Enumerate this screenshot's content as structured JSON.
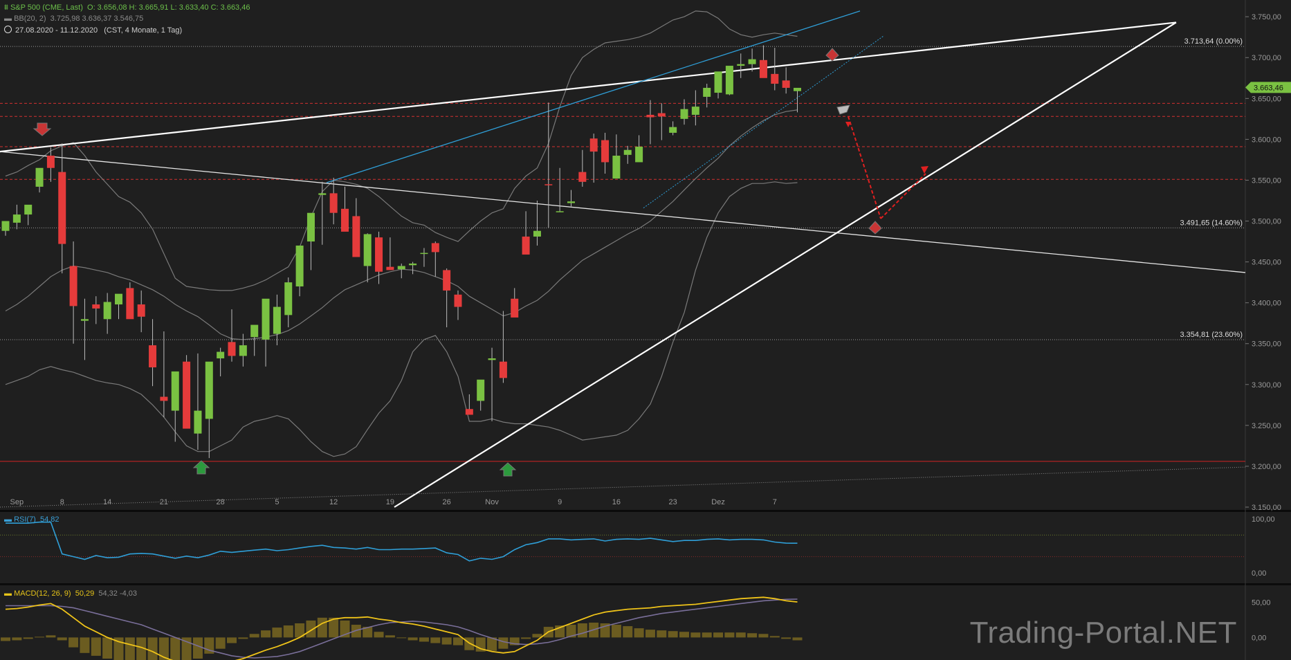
{
  "header": {
    "symbol_icon": "candlestick-icon",
    "symbol": "S&P 500 (CME, Last)",
    "ohlc": "O: 3.656,08  H: 3.665,91  L: 3.633,40  C: 3.663,46",
    "bb_label": "BB(20, 2)",
    "bb_values": "3.725,98  3.636,37  3.546,75",
    "range_icon": "clock-icon",
    "range": "27.08.2020 - 11.12.2020",
    "range_note": "(CST, 4 Monate, 1 Tag)"
  },
  "watermark": "Trading-Portal.NET",
  "colors": {
    "background": "#1f1f1f",
    "up": "#7ac142",
    "down": "#e53b3b",
    "rsi": "#2f9fd8",
    "macd": "#f0c419",
    "signal": "#7a6f9a",
    "hist": "#6b5c20"
  },
  "chart_data": [
    {
      "type": "candlestick",
      "title": "S&P 500 (CME, Last)",
      "x": [
        "31.08",
        "01.09",
        "02.09",
        "03.09",
        "04.09",
        "08.09",
        "09.09",
        "10.09",
        "11.09",
        "14.09",
        "15.09",
        "16.09",
        "17.09",
        "18.09",
        "21.09",
        "22.09",
        "23.09",
        "24.09",
        "25.09",
        "28.09",
        "29.09",
        "30.09",
        "01.10",
        "02.10",
        "05.10",
        "06.10",
        "07.10",
        "08.10",
        "09.10",
        "12.10",
        "13.10",
        "14.10",
        "15.10",
        "16.10",
        "19.10",
        "20.10",
        "21.10",
        "22.10",
        "23.10",
        "26.10",
        "27.10",
        "28.10",
        "29.10",
        "30.10",
        "02.11",
        "03.11",
        "04.11",
        "05.11",
        "06.11",
        "09.11",
        "10.11",
        "11.11",
        "12.11",
        "13.11",
        "16.11",
        "17.11",
        "18.11",
        "19.11",
        "20.11",
        "23.11",
        "24.11",
        "25.11",
        "27.11",
        "30.11",
        "01.12",
        "02.12",
        "03.12",
        "04.12",
        "07.12",
        "08.12",
        "09.12",
        "10.12",
        "11.12"
      ],
      "open": [
        3488,
        3498,
        3508,
        3542,
        3580,
        3560,
        3445,
        3378,
        3398,
        3380,
        3398,
        3418,
        3398,
        3348,
        3285,
        3268,
        3328,
        3240,
        3258,
        3332,
        3352,
        3335,
        3358,
        3355,
        3362,
        3385,
        3420,
        3475,
        3532,
        3534,
        3515,
        3506,
        3445,
        3480,
        3444,
        3441,
        3446,
        3460,
        3473,
        3440,
        3410,
        3270,
        3280,
        3330,
        3328,
        3405,
        3481,
        3481,
        3545,
        3511,
        3522,
        3560,
        3601,
        3599,
        3552,
        3581,
        3572,
        3630,
        3632,
        3608,
        3625,
        3630,
        3652,
        3657,
        3655,
        3690,
        3692,
        3697,
        3680,
        3672,
        3659
      ],
      "high": [
        3498,
        3520,
        3518,
        3550,
        3590,
        3595,
        3475,
        3405,
        3408,
        3412,
        3402,
        3425,
        3415,
        3380,
        3365,
        3290,
        3336,
        3338,
        3302,
        3345,
        3392,
        3362,
        3368,
        3385,
        3410,
        3431,
        3421,
        3482,
        3548,
        3553,
        3542,
        3528,
        3485,
        3487,
        3480,
        3448,
        3450,
        3467,
        3475,
        3442,
        3415,
        3288,
        3300,
        3345,
        3390,
        3418,
        3512,
        3525,
        3645,
        3565,
        3538,
        3587,
        3607,
        3608,
        3606,
        3592,
        3605,
        3648,
        3644,
        3622,
        3649,
        3660,
        3668,
        3680,
        3682,
        3705,
        3711,
        3715,
        3712,
        3688,
        3663
      ],
      "low": [
        3482,
        3490,
        3495,
        3535,
        3548,
        3436,
        3350,
        3330,
        3374,
        3362,
        3380,
        3390,
        3364,
        3298,
        3260,
        3230,
        3278,
        3220,
        3210,
        3310,
        3328,
        3322,
        3335,
        3322,
        3348,
        3370,
        3408,
        3440,
        3471,
        3496,
        3498,
        3490,
        3425,
        3423,
        3440,
        3430,
        3435,
        3444,
        3432,
        3370,
        3379,
        3268,
        3268,
        3255,
        3302,
        3402,
        3460,
        3470,
        3492,
        3511,
        3518,
        3542,
        3547,
        3558,
        3552,
        3570,
        3585,
        3594,
        3599,
        3605,
        3618,
        3617,
        3639,
        3650,
        3654,
        3675,
        3683,
        3685,
        3660,
        3656,
        3633
      ],
      "close": [
        3500,
        3508,
        3520,
        3565,
        3565,
        3472,
        3396,
        3380,
        3393,
        3401,
        3411,
        3380,
        3383,
        3321,
        3280,
        3316,
        3246,
        3268,
        3328,
        3340,
        3335,
        3348,
        3373,
        3405,
        3395,
        3425,
        3470,
        3510,
        3534,
        3510,
        3487,
        3456,
        3484,
        3438,
        3440,
        3445,
        3448,
        3461,
        3462,
        3415,
        3395,
        3263,
        3306,
        3332,
        3308,
        3382,
        3459,
        3488,
        3544,
        3512,
        3524,
        3548,
        3585,
        3572,
        3580,
        3587,
        3591,
        3627,
        3628,
        3615,
        3637,
        3640,
        3663,
        3683,
        3690,
        3692,
        3698,
        3675,
        3668,
        3663,
        3663
      ],
      "ylim": [
        3150,
        3762
      ],
      "ytick_labels": [
        "3.750,00",
        "3.700,00",
        "3.650,00",
        "3.600,00",
        "3.550,00",
        "3.500,00",
        "3.450,00",
        "3.400,00",
        "3.350,00",
        "3.300,00",
        "3.250,00",
        "3.200,00",
        "3.150,00"
      ],
      "yticks": [
        3750,
        3700,
        3650,
        3600,
        3550,
        3500,
        3450,
        3400,
        3350,
        3300,
        3250,
        3200,
        3150
      ],
      "xtick_labels": [
        "Sep",
        "8",
        "14",
        "21",
        "28",
        "5",
        "12",
        "19",
        "26",
        "Nov",
        "9",
        "16",
        "23",
        "Dez",
        "7"
      ],
      "xtick_index": [
        1,
        5,
        9,
        14,
        19,
        24,
        29,
        34,
        39,
        43,
        49,
        54,
        59,
        63,
        68
      ],
      "last_price_label": "3.663,46",
      "last_price": 3663.46,
      "fib_levels": [
        {
          "value": 3713.64,
          "label": "3.713,64 (0.00%)"
        },
        {
          "value": 3491.65,
          "label": "3.491,65 (14.60%)"
        },
        {
          "value": 3354.81,
          "label": "3.354,81 (23.60%)"
        }
      ],
      "red_dashed_levels": [
        3644,
        3628,
        3591,
        3551
      ],
      "support_level": 3206,
      "bb_upper": [
        3555,
        3560,
        3568,
        3575,
        3586,
        3592,
        3596,
        3580,
        3560,
        3545,
        3530,
        3523,
        3510,
        3490,
        3460,
        3430,
        3420,
        3418,
        3416,
        3415,
        3415,
        3418,
        3422,
        3428,
        3436,
        3444,
        3468,
        3505,
        3536,
        3550,
        3548,
        3545,
        3540,
        3530,
        3518,
        3506,
        3498,
        3495,
        3486,
        3480,
        3475,
        3488,
        3500,
        3510,
        3515,
        3540,
        3555,
        3565,
        3595,
        3640,
        3678,
        3700,
        3710,
        3718,
        3720,
        3722,
        3725,
        3730,
        3738,
        3746,
        3750,
        3757,
        3756,
        3748,
        3735,
        3728,
        3725,
        3728,
        3730,
        3728,
        3726
      ],
      "bb_middle": [
        3390,
        3398,
        3408,
        3420,
        3432,
        3440,
        3445,
        3443,
        3440,
        3437,
        3432,
        3428,
        3422,
        3416,
        3408,
        3398,
        3390,
        3383,
        3373,
        3362,
        3356,
        3355,
        3356,
        3358,
        3361,
        3366,
        3374,
        3384,
        3394,
        3406,
        3416,
        3422,
        3428,
        3434,
        3438,
        3441,
        3440,
        3437,
        3432,
        3427,
        3420,
        3408,
        3400,
        3392,
        3384,
        3388,
        3396,
        3403,
        3414,
        3428,
        3440,
        3452,
        3460,
        3468,
        3476,
        3484,
        3491,
        3500,
        3512,
        3524,
        3538,
        3552,
        3565,
        3577,
        3592,
        3604,
        3614,
        3623,
        3630,
        3634,
        3636
      ],
      "bb_lower": [
        3300,
        3305,
        3310,
        3318,
        3322,
        3318,
        3315,
        3310,
        3305,
        3302,
        3300,
        3295,
        3288,
        3275,
        3260,
        3242,
        3225,
        3218,
        3218,
        3225,
        3232,
        3248,
        3255,
        3258,
        3262,
        3258,
        3245,
        3230,
        3218,
        3212,
        3215,
        3224,
        3245,
        3265,
        3280,
        3305,
        3340,
        3355,
        3360,
        3340,
        3310,
        3255,
        3255,
        3258,
        3254,
        3252,
        3252,
        3250,
        3248,
        3244,
        3238,
        3232,
        3234,
        3236,
        3238,
        3244,
        3258,
        3276,
        3310,
        3352,
        3388,
        3440,
        3480,
        3510,
        3530,
        3540,
        3546,
        3546,
        3548,
        3546,
        3547
      ]
    },
    {
      "type": "line",
      "title": "RSI(7)",
      "legend_label": "RSI(7)",
      "legend_value": "54,82",
      "series": [
        {
          "name": "RSI(7)",
          "values": [
            92,
            92,
            92,
            94,
            94,
            35,
            30,
            25,
            32,
            28,
            29,
            35,
            36,
            35,
            31,
            27,
            31,
            28,
            33,
            40,
            38,
            40,
            42,
            44,
            41,
            43,
            46,
            49,
            51,
            47,
            46,
            44,
            47,
            43,
            43,
            44,
            44,
            45,
            46,
            37,
            34,
            22,
            27,
            25,
            30,
            43,
            52,
            56,
            63,
            63,
            61,
            62,
            63,
            59,
            62,
            63,
            62,
            64,
            61,
            58,
            60,
            60,
            62,
            63,
            61,
            62,
            62,
            61,
            57,
            55,
            54.82
          ]
        }
      ],
      "ylim": [
        0,
        100
      ],
      "yticks": [
        100,
        0
      ],
      "ytick_labels": [
        "100,00",
        "0,00"
      ],
      "reference_levels": [
        70,
        30
      ]
    },
    {
      "type": "line",
      "title": "MACD(12, 26, 9)",
      "legend_label": "MACD(12, 26, 9)",
      "legend_value": "50,29",
      "legend_extra": "54,32  -4,03",
      "series": [
        {
          "name": "MACD",
          "values": [
            40,
            41,
            43,
            46,
            48,
            40,
            28,
            16,
            8,
            0,
            -6,
            -10,
            -14,
            -20,
            -28,
            -34,
            -40,
            -42,
            -41,
            -38,
            -34,
            -30,
            -24,
            -18,
            -13,
            -7,
            0,
            10,
            20,
            26,
            28,
            28,
            29,
            26,
            24,
            21,
            19,
            16,
            12,
            8,
            4,
            -8,
            -16,
            -20,
            -22,
            -20,
            -12,
            -4,
            8,
            14,
            20,
            26,
            32,
            36,
            38,
            40,
            41,
            42,
            44,
            45,
            46,
            47,
            49,
            51,
            53,
            55,
            56,
            57,
            55,
            52,
            50.29
          ]
        },
        {
          "name": "Signal",
          "values": [
            45,
            45,
            45,
            45,
            45,
            44,
            42,
            38,
            34,
            30,
            26,
            22,
            18,
            12,
            6,
            0,
            -6,
            -12,
            -18,
            -22,
            -26,
            -28,
            -29,
            -28,
            -27,
            -24,
            -20,
            -14,
            -8,
            -2,
            4,
            10,
            14,
            18,
            21,
            22,
            23,
            22,
            20,
            18,
            15,
            10,
            4,
            -1,
            -6,
            -9,
            -10,
            -9,
            -7,
            -3,
            2,
            6,
            11,
            16,
            20,
            24,
            28,
            31,
            34,
            36,
            38,
            40,
            42,
            44,
            46,
            48,
            50,
            52,
            53,
            54,
            54.32
          ]
        }
      ],
      "ylim": [
        -30,
        70
      ],
      "yticks": [
        50,
        0
      ],
      "ytick_labels": [
        "50,00",
        "0,00"
      ]
    }
  ]
}
